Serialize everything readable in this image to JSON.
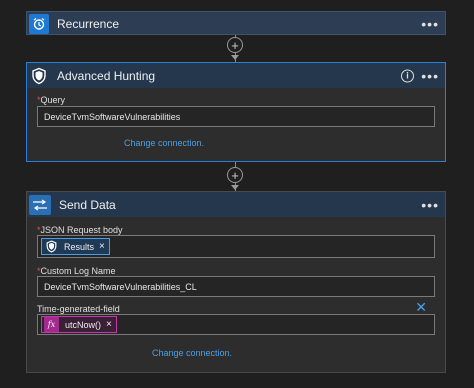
{
  "recurrence": {
    "title": "Recurrence",
    "icon": "alarm-clock-icon",
    "menu": "•••"
  },
  "advanced_hunting": {
    "title": "Advanced Hunting",
    "icon": "shield-icon",
    "menu": "•••",
    "info": "i",
    "query_label": "Query",
    "query_value": "DeviceTvmSoftwareVulnerabilities",
    "change_connection": "Change connection."
  },
  "send_data": {
    "title": "Send Data",
    "icon": "arrows-icon",
    "menu": "•••",
    "json_label": "JSON Request body",
    "json_token": "Results",
    "log_label": "Custom Log Name",
    "log_value": "DeviceTvmSoftwareVulnerabilities_CL",
    "time_label": "Time-generated-field",
    "time_token": "utcNow()",
    "fx": "fx",
    "token_close": "×",
    "change_connection": "Change connection."
  },
  "connectors": {
    "plus": "+"
  },
  "colors": {
    "accent": "#2b7fd6",
    "link": "#4aa0e6",
    "required": "#e05050",
    "expression": "#a32a8f"
  }
}
